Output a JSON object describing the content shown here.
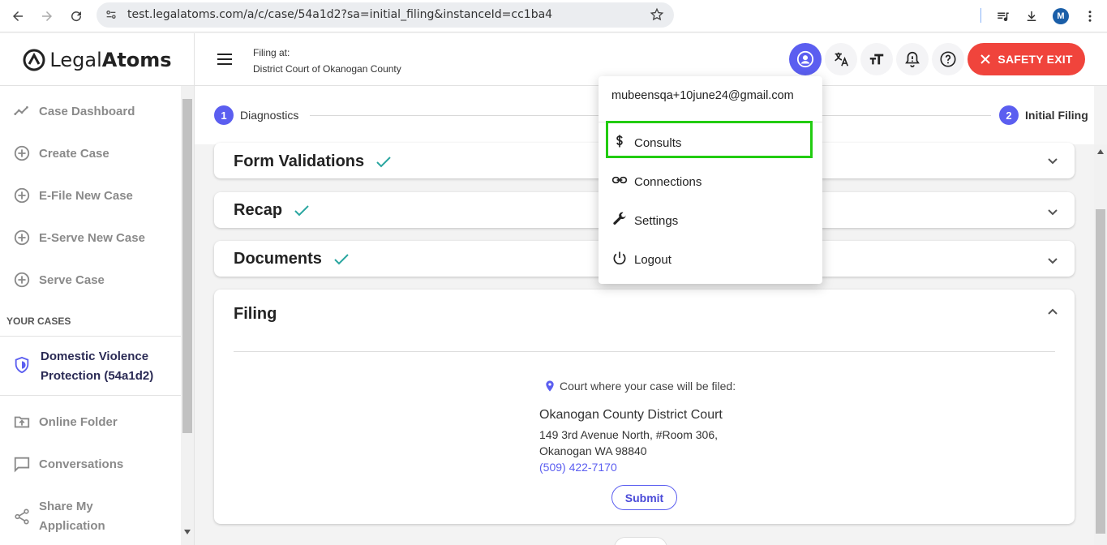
{
  "browser": {
    "url": "test.legalatoms.com/a/c/case/54a1d2?sa=initial_filing&instanceId=cc1ba4",
    "profile_initial": "M"
  },
  "header": {
    "logo_light": "Legal",
    "logo_bold": "Atoms",
    "filing_at_label": "Filing at:",
    "filing_at_court": "District Court of Okanogan County",
    "safety_exit": "SAFETY EXIT"
  },
  "sidebar": {
    "items": [
      {
        "label": "Case Dashboard",
        "icon": "chart-line-icon"
      },
      {
        "label": "Create Case",
        "icon": "plus-circle-icon"
      },
      {
        "label": "E-File New Case",
        "icon": "plus-circle-icon"
      },
      {
        "label": "E-Serve New Case",
        "icon": "plus-circle-icon"
      },
      {
        "label": "Serve Case",
        "icon": "plus-circle-icon"
      }
    ],
    "your_cases": "YOUR CASES",
    "case_line1": "Domestic Violence",
    "case_line2": "Protection (54a1d2)",
    "bottom_items": [
      {
        "label": "Online Folder",
        "icon": "folder-upload-icon"
      },
      {
        "label": "Conversations",
        "icon": "chat-icon"
      },
      {
        "label_line1": "Share My",
        "label_line2": "Application",
        "icon": "share-icon"
      }
    ]
  },
  "stepper": {
    "steps": [
      {
        "num": "1",
        "label": "Diagnostics"
      },
      {
        "num": "2",
        "label": "Initial Filing"
      }
    ]
  },
  "cards": {
    "form_validations": "Form Validations",
    "recap": "Recap",
    "documents": "Documents",
    "filing": "Filing"
  },
  "filing": {
    "court_heading": "Court where your case will be filed:",
    "court_name": "Okanogan County District Court",
    "address1": "149 3rd Avenue North, #Room 306,",
    "address2": "Okanogan WA 98840",
    "phone": "(509) 422-7170",
    "submit": "Submit"
  },
  "dropdown": {
    "email": "mubeensqa+10june24@gmail.com",
    "items": [
      "Consults",
      "Connections",
      "Settings",
      "Logout"
    ]
  },
  "colors": {
    "accent": "#5b5ef0",
    "danger": "#f0443c",
    "highlight": "#22cc11",
    "check": "#2aa6a0"
  }
}
